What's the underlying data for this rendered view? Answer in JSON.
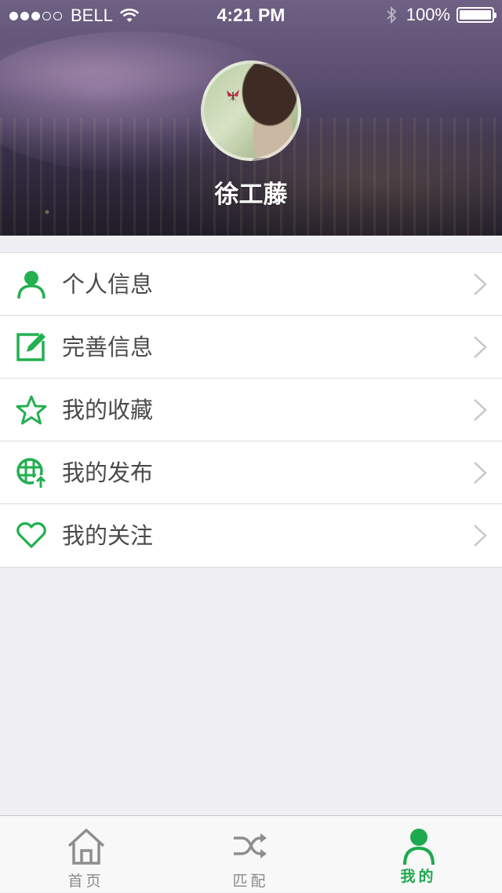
{
  "status_bar": {
    "carrier": "BELL",
    "time": "4:21 PM",
    "battery": "100%",
    "signal_dots": 5,
    "signal_filled": 3
  },
  "profile": {
    "username": "徐工藤"
  },
  "menu": {
    "items": [
      {
        "label": "个人信息",
        "icon": "person-icon"
      },
      {
        "label": "完善信息",
        "icon": "edit-icon"
      },
      {
        "label": "我的收藏",
        "icon": "star-icon"
      },
      {
        "label": "我的发布",
        "icon": "globe-upload-icon"
      },
      {
        "label": "我的关注",
        "icon": "heart-icon"
      }
    ]
  },
  "tabbar": {
    "tabs": [
      {
        "label": "首页",
        "icon": "home-icon"
      },
      {
        "label": "匹配",
        "icon": "shuffle-icon"
      },
      {
        "label": "我的",
        "icon": "person-icon",
        "active": true
      }
    ]
  },
  "colors": {
    "accent": "#1ea94e",
    "icon_green": "#22b04f",
    "chevron": "#c7c7cc",
    "background": "#efeff4"
  }
}
